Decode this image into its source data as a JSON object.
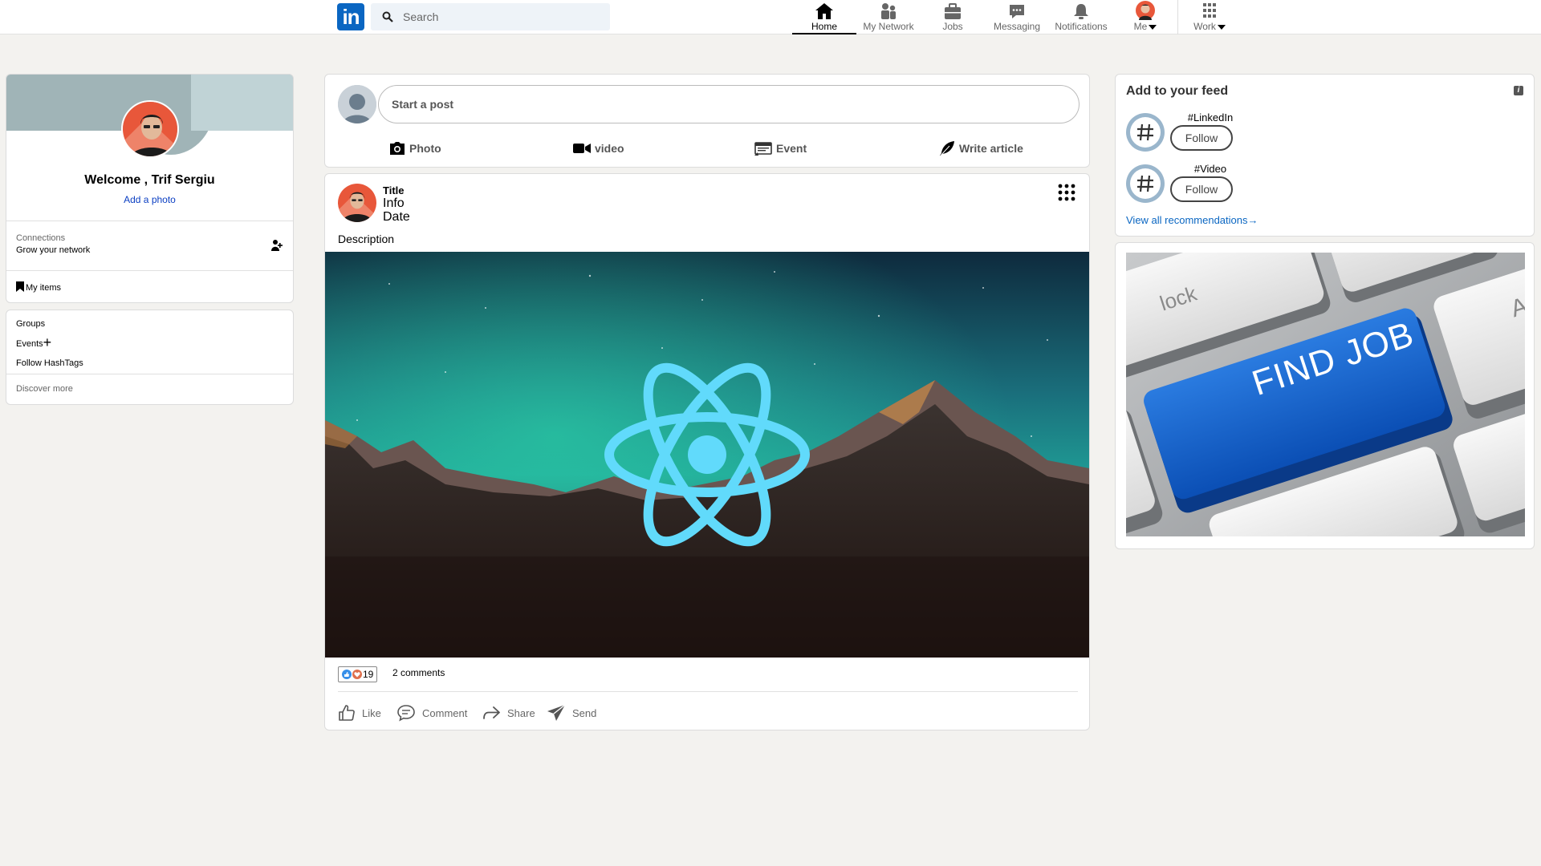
{
  "header": {
    "logo_text": "in",
    "search_placeholder": "Search",
    "nav": [
      {
        "label": "Home",
        "icon": "home-icon",
        "active": true
      },
      {
        "label": "My Network",
        "icon": "network-icon"
      },
      {
        "label": "Jobs",
        "icon": "briefcase-icon"
      },
      {
        "label": "Messaging",
        "icon": "messaging-icon"
      },
      {
        "label": "Notifications",
        "icon": "bell-icon"
      },
      {
        "label": "Me",
        "icon": "avatar"
      },
      {
        "label": "Work",
        "icon": "grid-icon"
      }
    ]
  },
  "profile": {
    "welcome": "Welcome , Trif Sergiu",
    "add_photo": "Add a photo",
    "connections_label": "Connections",
    "connections_sub": "Grow your network",
    "my_items": "My items"
  },
  "groups_card": {
    "groups": "Groups",
    "events": "Events",
    "events_plus": "+",
    "follow_hashtags": "Follow HashTags",
    "discover_more": "Discover more"
  },
  "start_post": {
    "placeholder": "Start a post",
    "actions": [
      {
        "label": "Photo",
        "icon": "camera-icon"
      },
      {
        "label": "video",
        "icon": "video-icon"
      },
      {
        "label": "Event",
        "icon": "calendar-icon"
      },
      {
        "label": "Write article",
        "icon": "feather-icon"
      }
    ]
  },
  "post": {
    "title": "Title",
    "info": "Info",
    "date": "Date",
    "description": "Description",
    "reaction_count": "19",
    "comments": "2 comments",
    "actions": [
      {
        "label": "Like",
        "icon": "like-icon"
      },
      {
        "label": "Comment",
        "icon": "comment-icon"
      },
      {
        "label": "Share",
        "icon": "share-icon"
      },
      {
        "label": "Send",
        "icon": "send-icon"
      }
    ]
  },
  "feed": {
    "title": "Add to your feed",
    "info_icon": "i",
    "items": [
      {
        "tag": "#LinkedIn",
        "follow": "Follow"
      },
      {
        "tag": "#Video",
        "follow": "Follow"
      }
    ],
    "view_all": "View all recommendations",
    "view_all_arrow": "→"
  },
  "ad": {
    "key_main": "FIND JOB",
    "key_other": "lock",
    "key_edge": "A"
  },
  "colors": {
    "brand": "#0a66c2",
    "background": "#f3f2ef",
    "react_blue": "#61dafb"
  }
}
